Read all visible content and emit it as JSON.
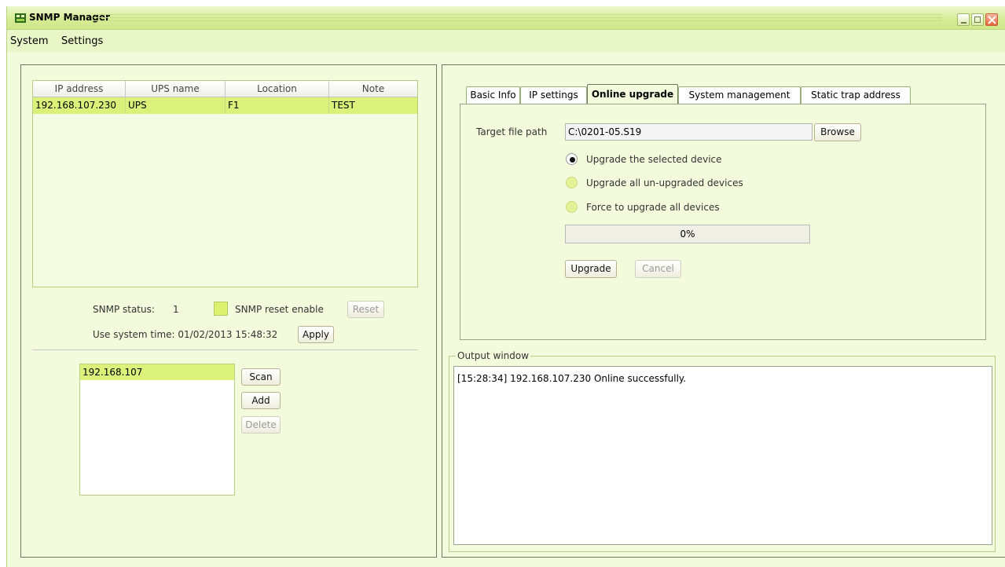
{
  "window": {
    "title": "SNMP Manager",
    "icon": "snmp-app-icon"
  },
  "menu": [
    "System",
    "Settings"
  ],
  "device_table": {
    "columns": [
      "IP address",
      "UPS name",
      "Location",
      "Note"
    ],
    "rows": [
      [
        "192.168.107.230",
        "UPS",
        "F1",
        "TEST"
      ]
    ]
  },
  "snmp": {
    "status_label": "SNMP status:",
    "status_value": "1",
    "reset_enable_label": "SNMP reset enable",
    "reset_enabled": false,
    "reset_button": "Reset",
    "system_time_label": "Use system time: 01/02/2013 15:48:32",
    "apply_button": "Apply"
  },
  "subnet_list": {
    "items": [
      "192.168.107"
    ]
  },
  "scan_buttons": {
    "scan": "Scan",
    "add": "Add",
    "delete": "Delete"
  },
  "tabs": [
    "Basic Info",
    "IP settings",
    "Online upgrade",
    "System management",
    "Static trap address"
  ],
  "active_tab": "Online upgrade",
  "upgrade": {
    "target_label": "Target file path",
    "target_value": "C:\\0201-05.S19",
    "browse_button": "Browse",
    "options": [
      {
        "label": "Upgrade the selected device",
        "selected": true
      },
      {
        "label": "Upgrade all un-upgraded devices",
        "selected": false
      },
      {
        "label": "Force to upgrade all devices",
        "selected": false
      }
    ],
    "progress_text": "0%",
    "progress_value": 0,
    "upgrade_button": "Upgrade",
    "cancel_button": "Cancel"
  },
  "output": {
    "legend": "Output window",
    "lines": [
      "[15:28:34]  192.168.107.230 Online successfully."
    ]
  },
  "colors": {
    "accent": "#dbf27a",
    "background": "#f2fbdc",
    "frame": "#cfe78a"
  }
}
